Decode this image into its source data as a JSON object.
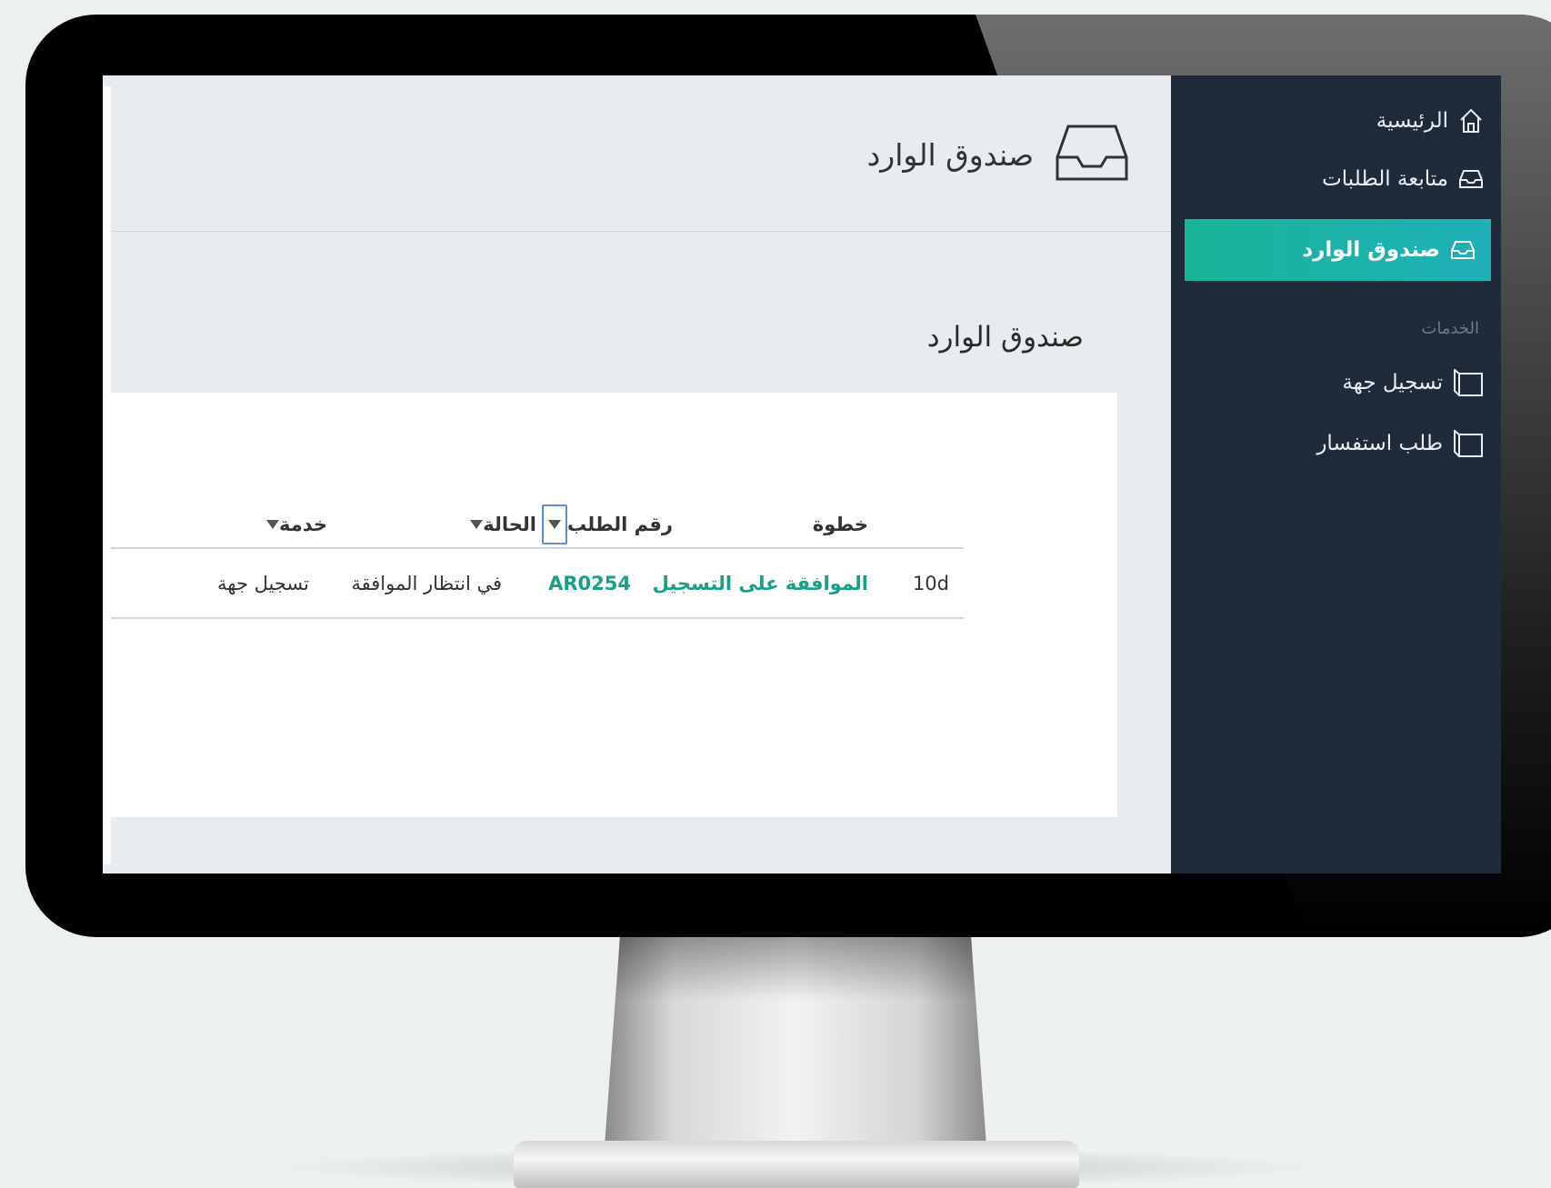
{
  "header": {
    "title": "صندوق الوارد",
    "icon": "inbox-icon"
  },
  "section": {
    "title": "صندوق الوارد"
  },
  "table": {
    "columns": [
      {
        "label": "خطوة"
      },
      {
        "label": "رقم الطلب"
      },
      {
        "label": "الحالة"
      },
      {
        "label": "خدمة"
      }
    ],
    "rows": [
      {
        "age": "10d",
        "step": "الموافقة على التسجيل",
        "request_no": "AR0254",
        "status": "في انتظار الموافقة",
        "service": "تسجيل جهة"
      }
    ]
  },
  "sidebar": {
    "items": [
      {
        "label": "الرئيسية",
        "icon": "home-icon"
      },
      {
        "label": "متابعة الطلبات",
        "icon": "inbox-icon"
      },
      {
        "label": "صندوق الوارد",
        "icon": "inbox-icon",
        "active": true
      }
    ],
    "services_label": "الخدمات",
    "services": [
      {
        "label": "تسجيل جهة",
        "icon": "copy-icon"
      },
      {
        "label": "طلب استفسار",
        "icon": "copy-icon"
      }
    ]
  },
  "colors": {
    "accent": "#19b497",
    "sidebar_bg": "#1f2b3a",
    "link_green": "#17a087",
    "main_bg": "#e8ecef"
  }
}
